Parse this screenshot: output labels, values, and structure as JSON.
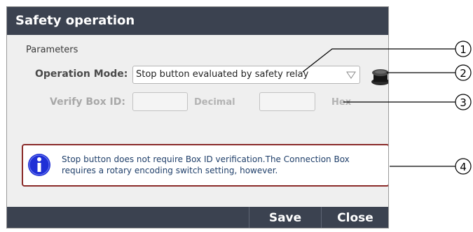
{
  "dialog": {
    "title": "Safety operation",
    "group_title": "Parameters",
    "operation_mode": {
      "label": "Operation Mode:",
      "value": "Stop button evaluated by safety relay"
    },
    "verify_box_id": {
      "label": "Verify Box ID:",
      "decimal_value": "",
      "decimal_unit": "Decimal",
      "hex_value": "",
      "hex_unit": "Hex"
    },
    "info_message": "Stop button does not require Box ID verification.The Connection Box requires a rotary encoding switch setting, however.",
    "buttons": {
      "save": "Save",
      "close": "Close"
    }
  },
  "callouts": [
    "1",
    "2",
    "3",
    "4"
  ],
  "colors": {
    "titlebar": "#3b4250",
    "info_border": "#8a2a28",
    "info_icon": "#1f2fd6",
    "info_text": "#1f3f6a"
  },
  "icons": {
    "select_arrow": "chevron-down-icon",
    "stop_button": "stop-button-icon",
    "info": "info-icon"
  }
}
